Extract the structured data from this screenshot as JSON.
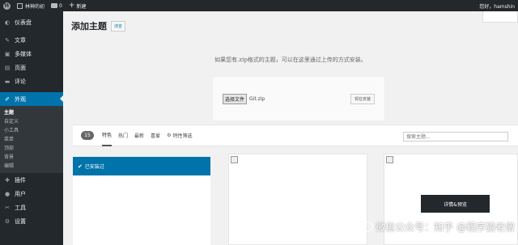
{
  "adminbar": {
    "site_name": "林神的初",
    "comments_count": "0",
    "new_label": "新建",
    "greeting": "您好，hamshin"
  },
  "sidebar": {
    "items_top": [
      {
        "label": "仪表盘",
        "icon": "dashboard-icon",
        "glyph": "◐"
      }
    ],
    "items_mid": [
      {
        "label": "文章",
        "icon": "pin-icon",
        "glyph": "✎"
      },
      {
        "label": "多媒体",
        "icon": "media-icon",
        "glyph": "▣"
      },
      {
        "label": "页面",
        "icon": "page-icon",
        "glyph": "▤"
      },
      {
        "label": "评论",
        "icon": "comment-icon",
        "glyph": "▬"
      }
    ],
    "current": {
      "label": "外观",
      "icon": "appearance-icon",
      "glyph": "✐"
    },
    "submenu": [
      "主题",
      "自定义",
      "小工具",
      "菜单",
      "顶部",
      "背景",
      "编辑"
    ],
    "items_bottom": [
      {
        "label": "插件",
        "icon": "plugin-icon",
        "glyph": "✚"
      },
      {
        "label": "用户",
        "icon": "user-icon",
        "glyph": "●"
      },
      {
        "label": "工具",
        "icon": "wrench-icon",
        "glyph": "✂"
      },
      {
        "label": "设置",
        "icon": "settings-icon",
        "glyph": "⚙"
      }
    ]
  },
  "main": {
    "title": "添加主题",
    "browse_label": "浏览",
    "upload_hint": "如果您有.zip格式的主题，可以在这里通过上传的方式安装。",
    "choose_file_label": "选择文件",
    "file_name": "Git.zip",
    "install_label": "现在安装"
  },
  "filter": {
    "count": "15",
    "tabs": [
      "特色",
      "热门",
      "最新",
      "喜爱"
    ],
    "feature_filter_label": "特性筛选",
    "search_placeholder": "搜索主题..."
  },
  "installed": {
    "label": "已安装过"
  },
  "theme_card": {
    "details_label": "详情&预览"
  },
  "watermark": {
    "text": "微信公众号：知乎 @程序猿老僧"
  }
}
